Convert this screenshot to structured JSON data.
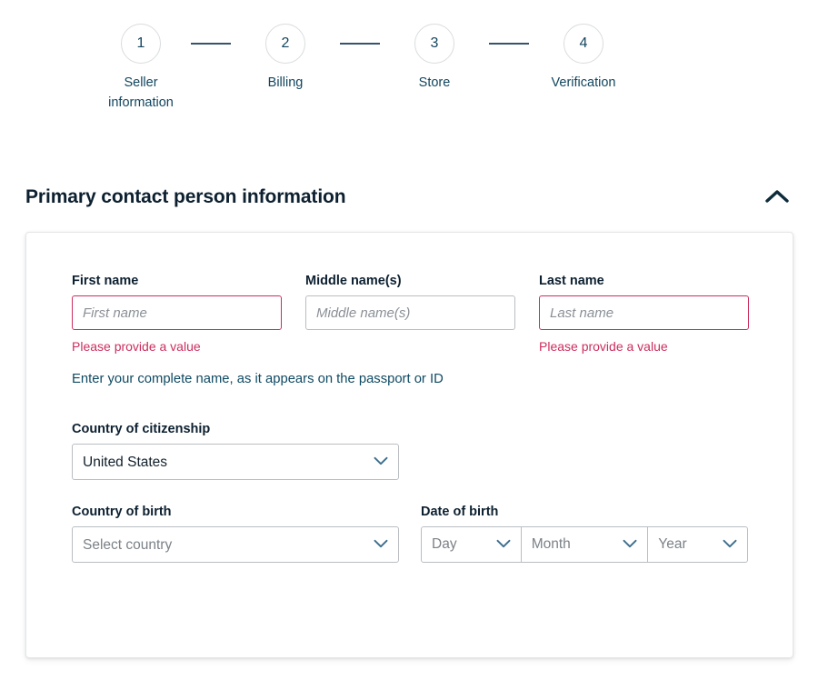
{
  "stepper": {
    "steps": [
      {
        "number": "1",
        "label": "Seller\ninformation"
      },
      {
        "number": "2",
        "label": "Billing"
      },
      {
        "number": "3",
        "label": "Store"
      },
      {
        "number": "4",
        "label": "Verification"
      }
    ],
    "connector_color": "#37536b",
    "circle_border_color": "#d9dcde",
    "number_color": "#14455f"
  },
  "section": {
    "title": "Primary contact person information",
    "collapse_icon": "chevron-up-icon",
    "expanded": true
  },
  "form": {
    "first_name": {
      "label": "First name",
      "placeholder": "First name",
      "value": "",
      "error": "Please provide a value",
      "has_error": true
    },
    "middle_name": {
      "label": "Middle name(s)",
      "placeholder": "Middle name(s)",
      "value": "",
      "has_error": false
    },
    "last_name": {
      "label": "Last name",
      "placeholder": "Last name",
      "value": "",
      "error": "Please provide a value",
      "has_error": true
    },
    "helper_text": "Enter your complete name, as it appears on the passport or ID",
    "country_of_citizenship": {
      "label": "Country of citizenship",
      "selected": "United States",
      "is_placeholder": false
    },
    "country_of_birth": {
      "label": "Country of birth",
      "selected": "Select country",
      "is_placeholder": true
    },
    "date_of_birth": {
      "label": "Date of birth",
      "day": "Day",
      "month": "Month",
      "year": "Year"
    }
  },
  "colors": {
    "error": "#cc2e5e",
    "label": "#0d2030",
    "helper": "#0f4a63",
    "border": "#b9bec2",
    "card_border": "#e3e6e8"
  }
}
